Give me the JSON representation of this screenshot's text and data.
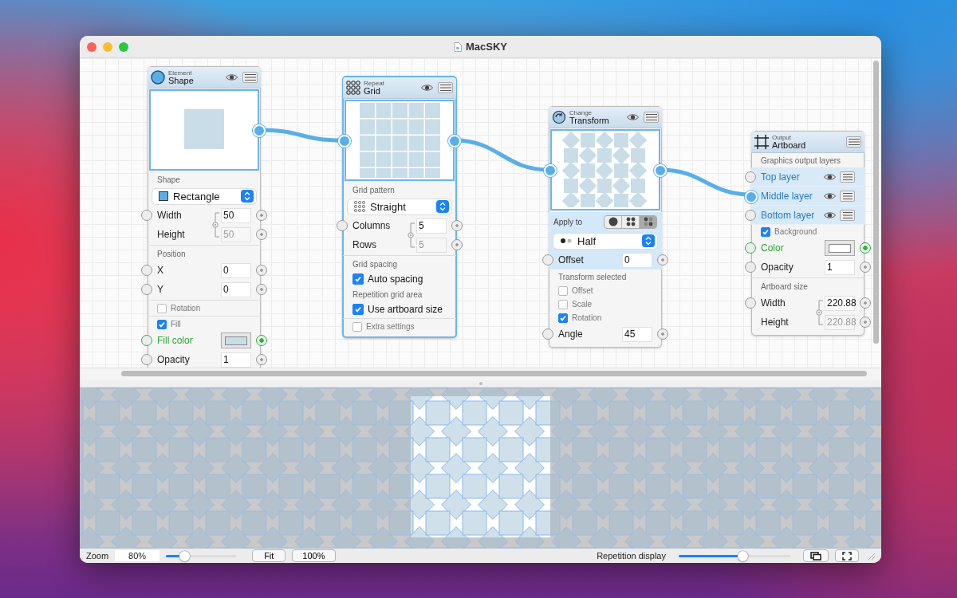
{
  "window": {
    "title": "MacSKY"
  },
  "nodes": [
    {
      "kind": "shape",
      "category": "Element",
      "title": "Shape",
      "eye": true,
      "selected": false,
      "rows": [
        {
          "kind": "preview"
        },
        {
          "kind": "heading",
          "label": "Shape"
        },
        {
          "kind": "select",
          "value": "Rectangle",
          "highlighted": false
        },
        {
          "kind": "pair",
          "items": [
            {
              "label": "Width",
              "value": "50"
            },
            {
              "label": "Height",
              "value": "50"
            }
          ]
        },
        {
          "kind": "divider"
        },
        {
          "kind": "heading",
          "label": "Position"
        },
        {
          "kind": "field",
          "label": "X",
          "value": "0",
          "highlighted": false
        },
        {
          "kind": "field",
          "label": "Y",
          "value": "0",
          "highlighted": false
        },
        {
          "kind": "divider"
        },
        {
          "kind": "checkbox",
          "label": "Rotation",
          "checked": false
        },
        {
          "kind": "divider"
        },
        {
          "kind": "checkbox",
          "label": "Fill",
          "checked": true
        },
        {
          "kind": "color",
          "label": "Fill color",
          "color": "#c9dde8"
        },
        {
          "kind": "field",
          "label": "Opacity",
          "value": "1",
          "highlighted": false
        }
      ]
    },
    {
      "kind": "grid",
      "category": "Repeat",
      "title": "Grid",
      "eye": true,
      "selected": true,
      "rows": [
        {
          "kind": "preview"
        },
        {
          "kind": "heading",
          "label": "Grid pattern"
        },
        {
          "kind": "select",
          "value": "Straight",
          "highlighted": false
        },
        {
          "kind": "pair",
          "items": [
            {
              "label": "Columns",
              "value": "5"
            },
            {
              "label": "Rows",
              "value": "5"
            }
          ]
        },
        {
          "kind": "divider"
        },
        {
          "kind": "heading",
          "label": "Grid spacing"
        },
        {
          "kind": "toggle",
          "label": "Auto spacing",
          "checked": true
        },
        {
          "kind": "heading",
          "label": "Repetition grid area"
        },
        {
          "kind": "toggle",
          "label": "Use artboard size",
          "checked": true
        },
        {
          "kind": "divider"
        },
        {
          "kind": "checkbox",
          "label": "Extra settings",
          "checked": false
        }
      ]
    },
    {
      "kind": "transform",
      "category": "Change",
      "title": "Transform",
      "eye": true,
      "selected": false,
      "rows": [
        {
          "kind": "preview"
        },
        {
          "kind": "segmented",
          "label": "Apply to",
          "options": [
            {
              "selected": false
            },
            {
              "selected": false
            },
            {
              "selected": true
            }
          ]
        },
        {
          "kind": "select",
          "value": "Half",
          "highlighted": true
        },
        {
          "kind": "field",
          "label": "Offset",
          "value": "0",
          "highlighted": true
        },
        {
          "kind": "heading",
          "label": "Transform selected"
        },
        {
          "kind": "checkbox",
          "label": "Offset",
          "checked": false
        },
        {
          "kind": "checkbox",
          "label": "Scale",
          "checked": false
        },
        {
          "kind": "checkbox",
          "label": "Rotation",
          "checked": true
        },
        {
          "kind": "field",
          "label": "Angle",
          "value": "45",
          "highlighted": false
        }
      ]
    },
    {
      "kind": "output",
      "category": "Output",
      "title": "Artboard",
      "eye": false,
      "selected": false,
      "rows": [
        {
          "kind": "heading",
          "label": "Graphics output layers"
        },
        {
          "kind": "layer",
          "label": "Top layer",
          "connected": false
        },
        {
          "kind": "layer",
          "label": "Middle layer",
          "connected": true
        },
        {
          "kind": "layer",
          "label": "Bottom layer",
          "connected": false
        },
        {
          "kind": "checkbox",
          "label": "Background",
          "checked": true
        },
        {
          "kind": "color",
          "label": "Color",
          "color": "#ffffff"
        },
        {
          "kind": "field",
          "label": "Opacity",
          "value": "1",
          "highlighted": false
        },
        {
          "kind": "divider"
        },
        {
          "kind": "heading",
          "label": "Artboard size"
        },
        {
          "kind": "pair",
          "items": [
            {
              "label": "Width",
              "value": "220.88"
            },
            {
              "label": "Height",
              "value": "220.88"
            }
          ]
        }
      ]
    }
  ],
  "cables": [
    {
      "kind": "cable"
    },
    {
      "kind": "cable"
    },
    {
      "kind": "cable"
    }
  ],
  "bottom_bar": {
    "zoom_label": "Zoom",
    "zoom_value": "80%",
    "zoom_slider": {
      "level": 0.22
    },
    "fit_button": "Fit",
    "actual_button": "100%",
    "repetition_label": "Repetition display",
    "repetition_slider": {
      "level": 0.58
    }
  }
}
